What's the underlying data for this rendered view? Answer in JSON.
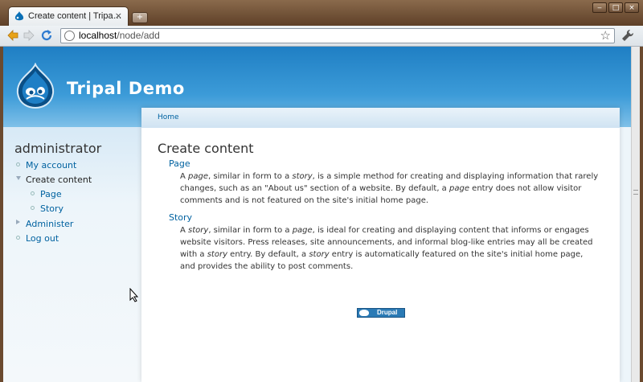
{
  "browser": {
    "tab_title": "Create content | Tripa…",
    "tab_close": "×",
    "new_tab": "+",
    "url_host": "localhost",
    "url_path": "/node/add",
    "min_btn": "‒",
    "max_btn": "□",
    "close_btn": "×"
  },
  "site": {
    "name": "Tripal Demo"
  },
  "sidebar": {
    "title": "administrator",
    "items": [
      {
        "label": "My account"
      },
      {
        "label": "Create content"
      },
      {
        "label": "Page"
      },
      {
        "label": "Story"
      },
      {
        "label": "Administer"
      },
      {
        "label": "Log out"
      }
    ]
  },
  "main": {
    "breadcrumb": "Home",
    "title": "Create content",
    "types": [
      {
        "name": "Page",
        "description_html": "A <i>page</i>, similar in form to a <i>story</i>, is a simple method for creating and displaying information that rarely changes, such as an \"About us\" section of a website. By default, a <i>page</i> entry does not allow visitor comments and is not featured on the site's initial home page."
      },
      {
        "name": "Story",
        "description_html": "A <i>story</i>, similar in form to a <i>page</i>, is ideal for creating and displaying content that informs or engages website visitors. Press releases, site announcements, and informal blog-like entries may all be created with a <i>story</i> entry. By default, a <i>story</i> entry is automatically featured on the site's initial home page, and provides the ability to post comments."
      }
    ],
    "badge": "Drupal"
  }
}
